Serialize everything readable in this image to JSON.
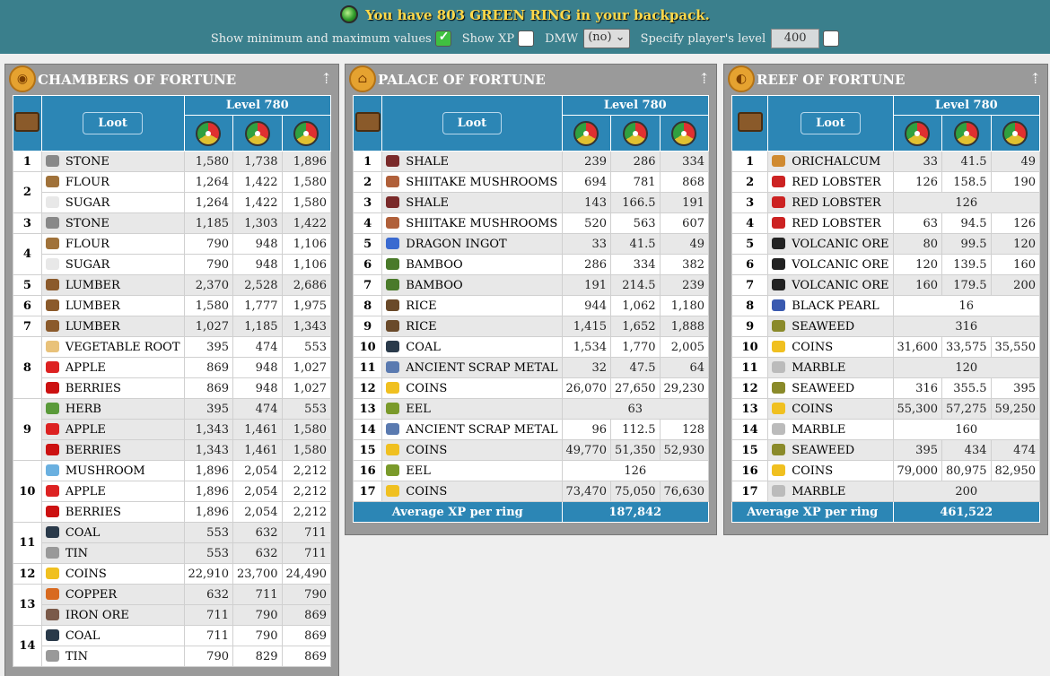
{
  "header": {
    "message": "You have 803 GREEN RING in your backpack.",
    "show_minmax_label": "Show minimum and maximum values",
    "show_xp_label": "Show XP",
    "dmw_label": "DMW",
    "dmw_value": "(no)",
    "level_label": "Specify player's level",
    "level_value": "400"
  },
  "colors": {
    "topbar": "#3a7f8c",
    "table_header": "#2c86b5",
    "panel": "#9a9a9a"
  },
  "panels": [
    {
      "title": "CHAMBERS OF FORTUNE",
      "icon": "eye-coin-icon",
      "loot_label": "Loot",
      "level_label": "Level 780",
      "rows": [
        {
          "i": "1",
          "item": "STONE",
          "ic": "#888",
          "min": "1,580",
          "avg": "1,738",
          "max": "1,896",
          "g": 1
        },
        {
          "i": "2",
          "item": "FLOUR",
          "ic": "#a0723a",
          "min": "1,264",
          "avg": "1,422",
          "max": "1,580",
          "g": 0
        },
        {
          "i": "",
          "item": "SUGAR",
          "ic": "#e8e8e8",
          "min": "1,264",
          "avg": "1,422",
          "max": "1,580",
          "g": 0
        },
        {
          "i": "3",
          "item": "STONE",
          "ic": "#888",
          "min": "1,185",
          "avg": "1,303",
          "max": "1,422",
          "g": 1
        },
        {
          "i": "4",
          "item": "FLOUR",
          "ic": "#a0723a",
          "min": "790",
          "avg": "948",
          "max": "1,106",
          "g": 0
        },
        {
          "i": "",
          "item": "SUGAR",
          "ic": "#e8e8e8",
          "min": "790",
          "avg": "948",
          "max": "1,106",
          "g": 0
        },
        {
          "i": "5",
          "item": "LUMBER",
          "ic": "#8b5a2b",
          "min": "2,370",
          "avg": "2,528",
          "max": "2,686",
          "g": 1
        },
        {
          "i": "6",
          "item": "LUMBER",
          "ic": "#8b5a2b",
          "min": "1,580",
          "avg": "1,777",
          "max": "1,975",
          "g": 0
        },
        {
          "i": "7",
          "item": "LUMBER",
          "ic": "#8b5a2b",
          "min": "1,027",
          "avg": "1,185",
          "max": "1,343",
          "g": 1
        },
        {
          "i": "8",
          "item": "VEGETABLE ROOT",
          "ic": "#e9c27a",
          "min": "395",
          "avg": "474",
          "max": "553",
          "g": 0
        },
        {
          "i": "",
          "item": "APPLE",
          "ic": "#d22",
          "min": "869",
          "avg": "948",
          "max": "1,027",
          "g": 0
        },
        {
          "i": "",
          "item": "BERRIES",
          "ic": "#c11",
          "min": "869",
          "avg": "948",
          "max": "1,027",
          "g": 0
        },
        {
          "i": "9",
          "item": "HERB",
          "ic": "#5a9a3a",
          "min": "395",
          "avg": "474",
          "max": "553",
          "g": 1
        },
        {
          "i": "",
          "item": "APPLE",
          "ic": "#d22",
          "min": "1,343",
          "avg": "1,461",
          "max": "1,580",
          "g": 1
        },
        {
          "i": "",
          "item": "BERRIES",
          "ic": "#c11",
          "min": "1,343",
          "avg": "1,461",
          "max": "1,580",
          "g": 1
        },
        {
          "i": "10",
          "item": "MUSHROOM",
          "ic": "#6ab0e0",
          "min": "1,896",
          "avg": "2,054",
          "max": "2,212",
          "g": 0
        },
        {
          "i": "",
          "item": "APPLE",
          "ic": "#d22",
          "min": "1,896",
          "avg": "2,054",
          "max": "2,212",
          "g": 0
        },
        {
          "i": "",
          "item": "BERRIES",
          "ic": "#c11",
          "min": "1,896",
          "avg": "2,054",
          "max": "2,212",
          "g": 0
        },
        {
          "i": "11",
          "item": "COAL",
          "ic": "#2a3a4a",
          "min": "553",
          "avg": "632",
          "max": "711",
          "g": 1
        },
        {
          "i": "",
          "item": "TIN",
          "ic": "#999",
          "min": "553",
          "avg": "632",
          "max": "711",
          "g": 1
        },
        {
          "i": "12",
          "item": "COINS",
          "ic": "#f0c020",
          "min": "22,910",
          "avg": "23,700",
          "max": "24,490",
          "g": 0
        },
        {
          "i": "13",
          "item": "COPPER",
          "ic": "#d86a20",
          "min": "632",
          "avg": "711",
          "max": "790",
          "g": 1
        },
        {
          "i": "",
          "item": "IRON ORE",
          "ic": "#7a5a4a",
          "min": "711",
          "avg": "790",
          "max": "869",
          "g": 1
        },
        {
          "i": "14",
          "item": "COAL",
          "ic": "#2a3a4a",
          "min": "711",
          "avg": "790",
          "max": "869",
          "g": 0
        },
        {
          "i": "",
          "item": "TIN",
          "ic": "#999",
          "min": "790",
          "avg": "829",
          "max": "869",
          "g": 0
        }
      ]
    },
    {
      "title": "PALACE OF FORTUNE",
      "icon": "pagoda-icon",
      "loot_label": "Loot",
      "level_label": "Level 780",
      "rows": [
        {
          "i": "1",
          "item": "SHALE",
          "ic": "#7a2a2a",
          "min": "239",
          "avg": "286",
          "max": "334",
          "g": 1
        },
        {
          "i": "2",
          "item": "SHIITAKE MUSHROOMS",
          "ic": "#b0603a",
          "min": "694",
          "avg": "781",
          "max": "868",
          "g": 0
        },
        {
          "i": "3",
          "item": "SHALE",
          "ic": "#7a2a2a",
          "min": "143",
          "avg": "166.5",
          "max": "191",
          "g": 1
        },
        {
          "i": "4",
          "item": "SHIITAKE MUSHROOMS",
          "ic": "#b0603a",
          "min": "520",
          "avg": "563",
          "max": "607",
          "g": 0
        },
        {
          "i": "5",
          "item": "DRAGON INGOT",
          "ic": "#3a6ad0",
          "min": "33",
          "avg": "41.5",
          "max": "49",
          "g": 1
        },
        {
          "i": "6",
          "item": "BAMBOO",
          "ic": "#4a7a2a",
          "min": "286",
          "avg": "334",
          "max": "382",
          "g": 0
        },
        {
          "i": "7",
          "item": "BAMBOO",
          "ic": "#4a7a2a",
          "min": "191",
          "avg": "214.5",
          "max": "239",
          "g": 1
        },
        {
          "i": "8",
          "item": "RICE",
          "ic": "#6a4a2a",
          "min": "944",
          "avg": "1,062",
          "max": "1,180",
          "g": 0
        },
        {
          "i": "9",
          "item": "RICE",
          "ic": "#6a4a2a",
          "min": "1,415",
          "avg": "1,652",
          "max": "1,888",
          "g": 1
        },
        {
          "i": "10",
          "item": "COAL",
          "ic": "#2a3a4a",
          "min": "1,534",
          "avg": "1,770",
          "max": "2,005",
          "g": 0
        },
        {
          "i": "11",
          "item": "ANCIENT SCRAP METAL",
          "ic": "#5a7ab0",
          "min": "32",
          "avg": "47.5",
          "max": "64",
          "g": 1
        },
        {
          "i": "12",
          "item": "COINS",
          "ic": "#f0c020",
          "min": "26,070",
          "avg": "27,650",
          "max": "29,230",
          "g": 0
        },
        {
          "i": "13",
          "item": "EEL",
          "ic": "#7a9a2a",
          "span": "63",
          "g": 1
        },
        {
          "i": "14",
          "item": "ANCIENT SCRAP METAL",
          "ic": "#5a7ab0",
          "min": "96",
          "avg": "112.5",
          "max": "128",
          "g": 0
        },
        {
          "i": "15",
          "item": "COINS",
          "ic": "#f0c020",
          "min": "49,770",
          "avg": "51,350",
          "max": "52,930",
          "g": 1
        },
        {
          "i": "16",
          "item": "EEL",
          "ic": "#7a9a2a",
          "span": "126",
          "g": 0
        },
        {
          "i": "17",
          "item": "COINS",
          "ic": "#f0c020",
          "min": "73,470",
          "avg": "75,050",
          "max": "76,630",
          "g": 1
        }
      ],
      "footer_label": "Average XP per ring",
      "footer_value": "187,842"
    },
    {
      "title": "REEF OF FORTUNE",
      "icon": "shell-icon",
      "loot_label": "Loot",
      "level_label": "Level 780",
      "rows": [
        {
          "i": "1",
          "item": "ORICHALCUM",
          "ic": "#d08a30",
          "min": "33",
          "avg": "41.5",
          "max": "49",
          "g": 1
        },
        {
          "i": "2",
          "item": "RED LOBSTER",
          "ic": "#c22",
          "min": "126",
          "avg": "158.5",
          "max": "190",
          "g": 0
        },
        {
          "i": "3",
          "item": "RED LOBSTER",
          "ic": "#c22",
          "span": "126",
          "g": 1
        },
        {
          "i": "4",
          "item": "RED LOBSTER",
          "ic": "#c22",
          "min": "63",
          "avg": "94.5",
          "max": "126",
          "g": 0
        },
        {
          "i": "5",
          "item": "VOLCANIC ORE",
          "ic": "#222",
          "min": "80",
          "avg": "99.5",
          "max": "120",
          "g": 1
        },
        {
          "i": "6",
          "item": "VOLCANIC ORE",
          "ic": "#222",
          "min": "120",
          "avg": "139.5",
          "max": "160",
          "g": 0
        },
        {
          "i": "7",
          "item": "VOLCANIC ORE",
          "ic": "#222",
          "min": "160",
          "avg": "179.5",
          "max": "200",
          "g": 1
        },
        {
          "i": "8",
          "item": "BLACK PEARL",
          "ic": "#3a5ab0",
          "span": "16",
          "g": 0
        },
        {
          "i": "9",
          "item": "SEAWEED",
          "ic": "#8a8a2a",
          "span": "316",
          "g": 1
        },
        {
          "i": "10",
          "item": "COINS",
          "ic": "#f0c020",
          "min": "31,600",
          "avg": "33,575",
          "max": "35,550",
          "g": 0
        },
        {
          "i": "11",
          "item": "MARBLE",
          "ic": "#bbb",
          "span": "120",
          "g": 1
        },
        {
          "i": "12",
          "item": "SEAWEED",
          "ic": "#8a8a2a",
          "min": "316",
          "avg": "355.5",
          "max": "395",
          "g": 0
        },
        {
          "i": "13",
          "item": "COINS",
          "ic": "#f0c020",
          "min": "55,300",
          "avg": "57,275",
          "max": "59,250",
          "g": 1
        },
        {
          "i": "14",
          "item": "MARBLE",
          "ic": "#bbb",
          "span": "160",
          "g": 0
        },
        {
          "i": "15",
          "item": "SEAWEED",
          "ic": "#8a8a2a",
          "min": "395",
          "avg": "434",
          "max": "474",
          "g": 1
        },
        {
          "i": "16",
          "item": "COINS",
          "ic": "#f0c020",
          "min": "79,000",
          "avg": "80,975",
          "max": "82,950",
          "g": 0
        },
        {
          "i": "17",
          "item": "MARBLE",
          "ic": "#bbb",
          "span": "200",
          "g": 1
        }
      ],
      "footer_label": "Average XP per ring",
      "footer_value": "461,522"
    }
  ]
}
